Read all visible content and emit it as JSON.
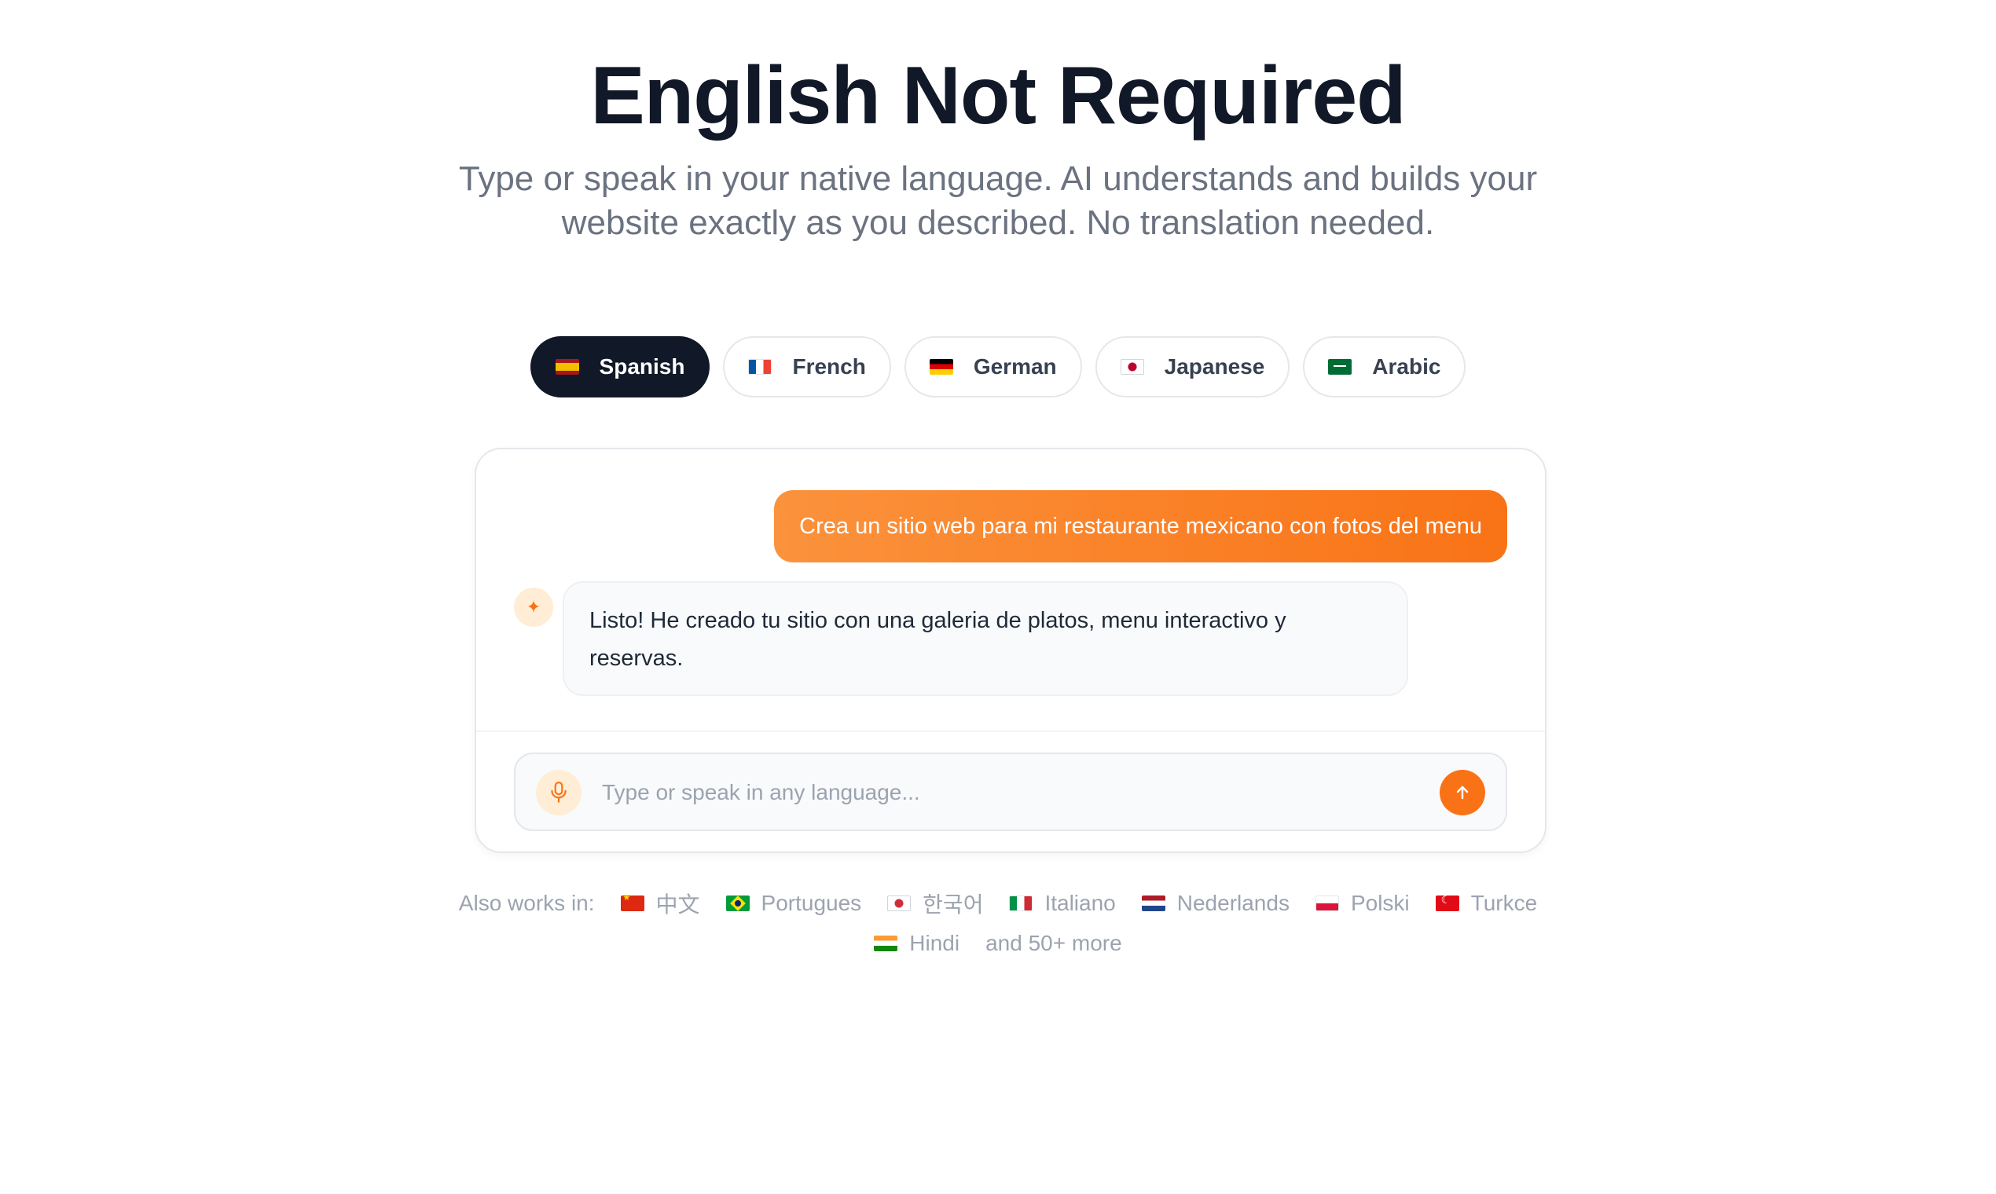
{
  "hero": {
    "title": "English Not Required",
    "subtitle": "Type or speak in your native language. AI understands and builds your website exactly as you described. No translation needed."
  },
  "language_tabs": [
    {
      "label": "Spanish",
      "flag": "es",
      "active": true
    },
    {
      "label": "French",
      "flag": "fr",
      "active": false
    },
    {
      "label": "German",
      "flag": "de",
      "active": false
    },
    {
      "label": "Japanese",
      "flag": "jp",
      "active": false
    },
    {
      "label": "Arabic",
      "flag": "sa",
      "active": false
    }
  ],
  "chat": {
    "user_message": "Crea un sitio web para mi restaurante mexicano con fotos del menu",
    "ai_message": "Listo! He creado tu sitio con una galeria de platos, menu interactivo y reservas.",
    "ai_avatar_icon": "sparkle-icon",
    "input_placeholder": "Type or speak in any language...",
    "input_value": "",
    "mic_icon": "microphone-icon",
    "send_icon": "arrow-up-icon"
  },
  "also_works": {
    "label": "Also works in:",
    "languages": [
      {
        "name": "中文",
        "flag": "cn"
      },
      {
        "name": "Portugues",
        "flag": "br"
      },
      {
        "name": "한국어",
        "flag": "kr"
      },
      {
        "name": "Italiano",
        "flag": "it"
      },
      {
        "name": "Nederlands",
        "flag": "nl"
      },
      {
        "name": "Polski",
        "flag": "pl"
      },
      {
        "name": "Turkce",
        "flag": "tr"
      },
      {
        "name": "Hindi",
        "flag": "in"
      }
    ],
    "more": "and 50+ more"
  },
  "colors": {
    "accent": "#f97316",
    "accent_light": "#ffedd5",
    "dark": "#111827",
    "muted": "#6b7280"
  }
}
